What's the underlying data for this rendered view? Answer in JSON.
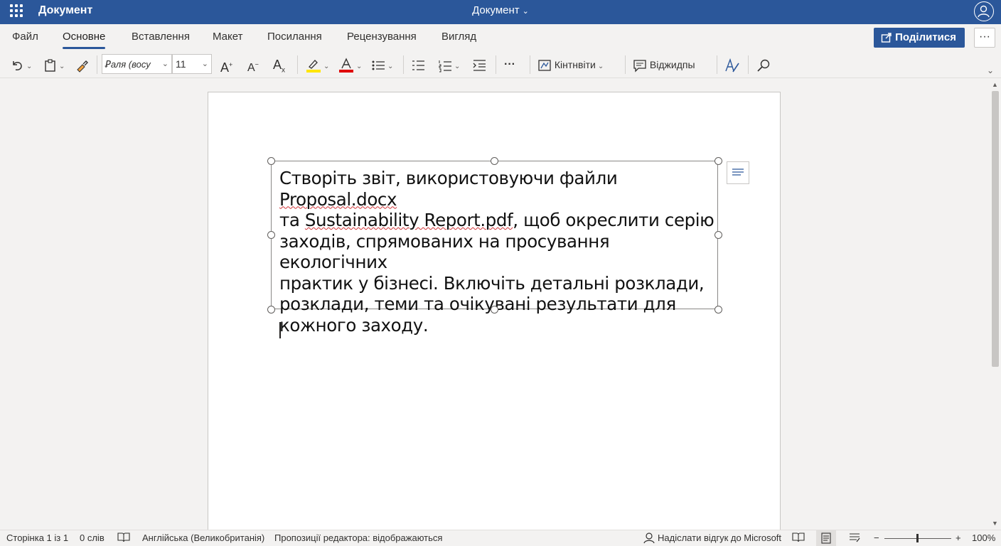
{
  "titlebar": {
    "app_name": "Документ",
    "doc_title": "Документ",
    "doc_title_chevron": "⌄"
  },
  "ribbon": {
    "tabs": [
      {
        "label": "Файл",
        "active": false
      },
      {
        "label": "Основне",
        "active": true
      },
      {
        "label": "Вставлення",
        "active": false
      },
      {
        "label": "Макет",
        "active": false
      },
      {
        "label": "Посилання",
        "active": false
      },
      {
        "label": "Рецензування",
        "active": false
      },
      {
        "label": "Вигляд",
        "active": false
      }
    ],
    "share_label": "Поділитися",
    "more_label": "···"
  },
  "toolbar": {
    "font_name": "Ꝑаля (восу",
    "font_size": "11",
    "more_label": "···",
    "styles_label": "Кінтнвіти",
    "comments_label": "Віджидпы",
    "accent_highlight": "#ffe600",
    "accent_font_color": "#e00000"
  },
  "document": {
    "textbox_lines": [
      [
        "Створіть звіт, використовуючи файли ",
        "Proposal.docx",
        ""
      ],
      [
        "та ",
        "Sustainability Report.pdf",
        ", щоб окреслити серію"
      ],
      [
        "заходів, спрямованих на просування екологічних",
        "",
        ""
      ],
      [
        "практик у бізнесі. Включіть детальні розклади,",
        "",
        ""
      ],
      [
        "розклади, теми та очікувані результати для",
        "",
        ""
      ],
      [
        "кожного заходу.",
        "",
        ""
      ]
    ]
  },
  "statusbar": {
    "page": "Сторінка 1 із 1",
    "words": "0 слів",
    "language": "Англійська (Великобританія)",
    "editor": "Пропозиції редактора: відображаються",
    "feedback": "Надіслати відгук до Microsoft",
    "zoom_minus": "−",
    "zoom_plus": "+",
    "zoom": "100%"
  }
}
